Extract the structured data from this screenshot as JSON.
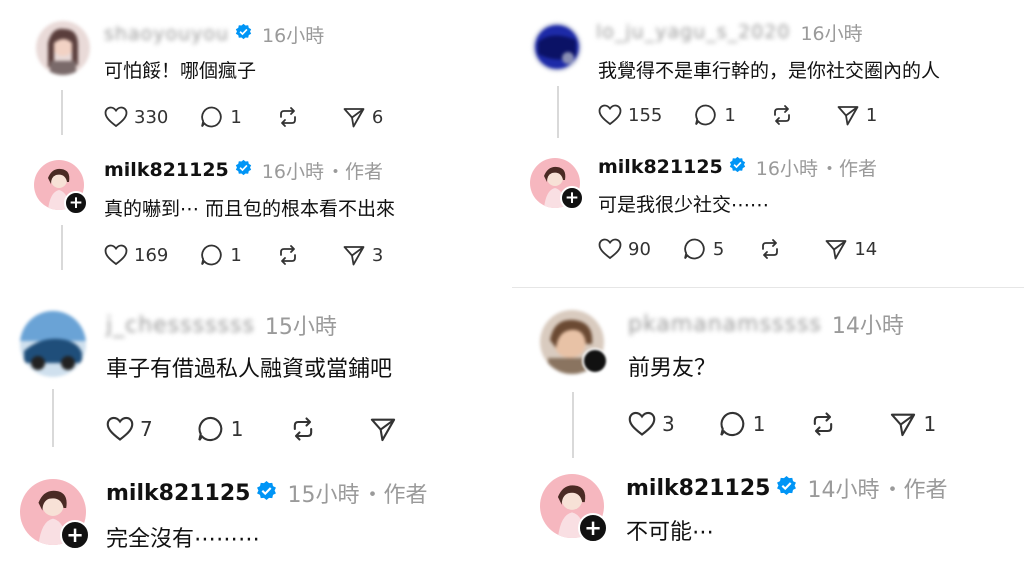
{
  "panels": [
    {
      "comments": [
        {
          "user": "shaoyouyou",
          "verified": true,
          "time": "16小時",
          "author_tag": "",
          "text": "可怕餒！哪個瘋子",
          "likes": "330",
          "replies": "1",
          "reposts": "",
          "shares": "6"
        },
        {
          "user": "milk821125",
          "verified": true,
          "time": "16小時",
          "author_tag": "・作者",
          "text": "真的嚇到⋯ 而且包的根本看不出來",
          "likes": "169",
          "replies": "1",
          "reposts": "",
          "shares": "3"
        }
      ]
    },
    {
      "comments": [
        {
          "user": "lo_ju_yagu_s_2020",
          "verified": false,
          "time": "16小時",
          "author_tag": "",
          "text": "我覺得不是車行幹的，是你社交圈內的人",
          "likes": "155",
          "replies": "1",
          "reposts": "",
          "shares": "1"
        },
        {
          "user": "milk821125",
          "verified": true,
          "time": "16小時",
          "author_tag": "・作者",
          "text": "可是我很少社交⋯⋯",
          "likes": "90",
          "replies": "5",
          "reposts": "",
          "shares": "14"
        }
      ]
    },
    {
      "comments": [
        {
          "user": "j_chesssssss",
          "verified": false,
          "time": "15小時",
          "author_tag": "",
          "text": "車子有借過私人融資或當鋪吧",
          "likes": "7",
          "replies": "1",
          "reposts": "",
          "shares": ""
        },
        {
          "user": "milk821125",
          "verified": true,
          "time": "15小時",
          "author_tag": "・作者",
          "text": "完全沒有⋯⋯⋯",
          "likes": "",
          "replies": "",
          "reposts": "",
          "shares": ""
        }
      ]
    },
    {
      "comments": [
        {
          "user": "pkamanamsssss",
          "verified": false,
          "time": "14小時",
          "author_tag": "",
          "text": "前男友？",
          "likes": "3",
          "replies": "1",
          "reposts": "",
          "shares": "1"
        },
        {
          "user": "milk821125",
          "verified": true,
          "time": "14小時",
          "author_tag": "・作者",
          "text": "不可能⋯",
          "likes": "",
          "replies": "",
          "reposts": "",
          "shares": ""
        }
      ]
    }
  ],
  "colors": {
    "verified": "#0095f6",
    "meta": "#9a9a9a",
    "thread_line": "#d9d9d9",
    "icon": "#333333"
  },
  "icons": [
    "heart-icon",
    "reply-icon",
    "repost-icon",
    "share-icon",
    "verified-icon",
    "follow-plus-icon"
  ]
}
